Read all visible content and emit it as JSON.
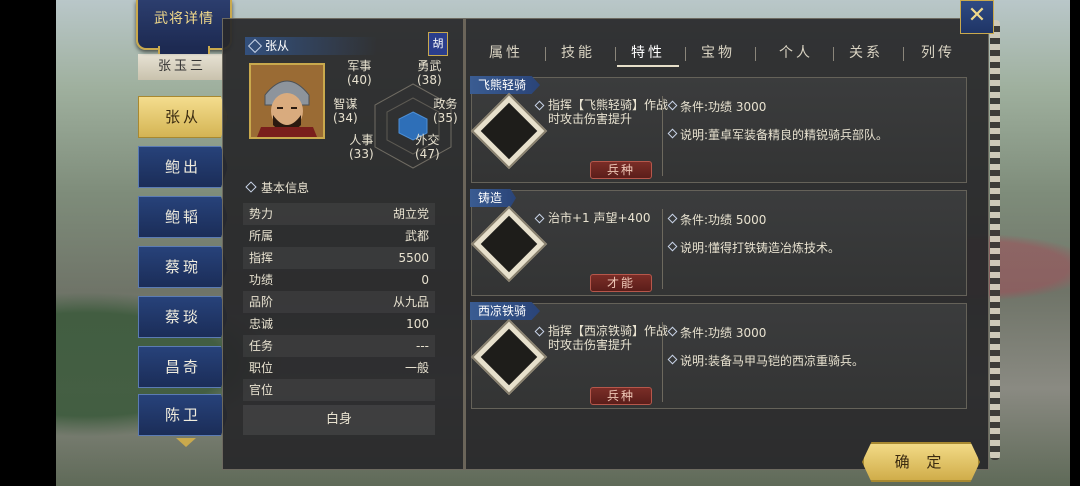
{
  "title_banner": "武将详情",
  "general_list": {
    "partial_top": "张玉三",
    "items": [
      "张从",
      "鲍出",
      "鲍韬",
      "蔡琬",
      "蔡琰",
      "昌奇",
      "陈卫"
    ],
    "active_index": 0
  },
  "profile": {
    "name": "张从",
    "faction_tag": "胡",
    "stats": {
      "military_label": "军事",
      "military_value": "(40)",
      "valor_label": "勇武",
      "valor_value": "(38)",
      "strategy_label": "智谋",
      "strategy_value": "(34)",
      "politics_label": "政务",
      "politics_value": "(35)",
      "personnel_label": "人事",
      "personnel_value": "(33)",
      "diplomacy_label": "外交",
      "diplomacy_value": "(47)"
    },
    "section_basic": "基本信息",
    "rows": [
      {
        "k": "势力",
        "v": "胡立党"
      },
      {
        "k": "所属",
        "v": "武都"
      },
      {
        "k": "指挥",
        "v": "5500"
      },
      {
        "k": "功绩",
        "v": "0"
      },
      {
        "k": "品阶",
        "v": "从九品"
      },
      {
        "k": "忠诚",
        "v": "100"
      },
      {
        "k": "任务",
        "v": "---"
      },
      {
        "k": "职位",
        "v": "一般"
      },
      {
        "k": "官位",
        "v": ""
      }
    ],
    "rank_title": "白身"
  },
  "tabs": [
    "属性",
    "技能",
    "特性",
    "宝物",
    "个人",
    "关系",
    "列传"
  ],
  "active_tab": 2,
  "traits": [
    {
      "name": "飞熊轻骑",
      "desc": "指挥【飞熊轻骑】作战时攻击伤害提升",
      "condition": "条件:功绩 3000",
      "note": "说明:董卓军装备精良的精锐骑兵部队。",
      "badge": "兵种",
      "icon": "cavalry-icon"
    },
    {
      "name": "铸造",
      "desc": "治市+1 声望+400",
      "condition": "条件:功绩 5000",
      "note": "说明:懂得打铁铸造冶炼技术。",
      "badge": "才能",
      "icon": "forge-icon"
    },
    {
      "name": "西凉铁骑",
      "desc": "指挥【西凉铁骑】作战时攻击伤害提升",
      "condition": "条件:功绩 3000",
      "note": "说明:装备马甲马铠的西凉重骑兵。",
      "badge": "兵种",
      "icon": "cavalry-icon"
    }
  ],
  "buttons": {
    "confirm": "确 定",
    "close": "✕"
  }
}
